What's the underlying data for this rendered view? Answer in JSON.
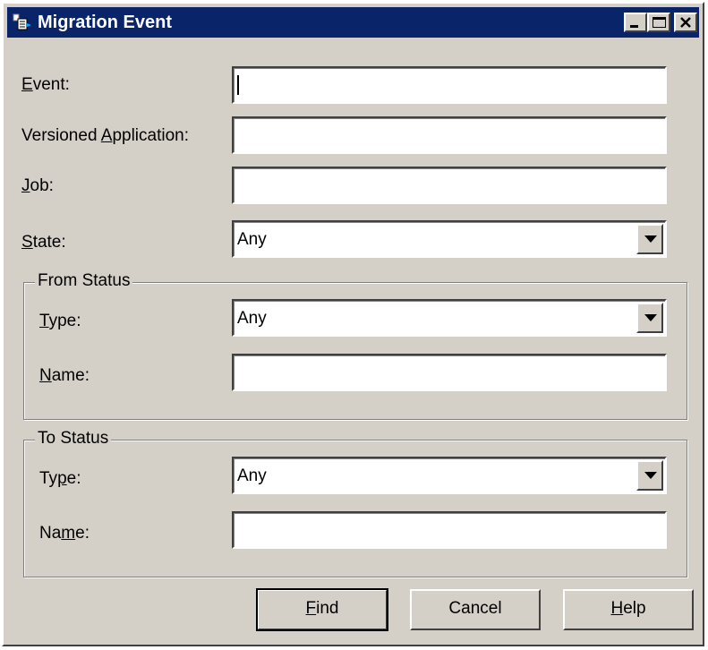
{
  "window": {
    "title": "Migration Event",
    "controls": {
      "minimize": "minimize",
      "maximize": "maximize",
      "close": "close"
    }
  },
  "form": {
    "event": {
      "label_mnemonic": "E",
      "label_rest": "vent:",
      "value": ""
    },
    "versioned_application": {
      "label_pre": "Versioned ",
      "label_mnemonic": "A",
      "label_rest": "pplication:",
      "value": ""
    },
    "job": {
      "label_mnemonic": "J",
      "label_rest": "ob:",
      "value": ""
    },
    "state": {
      "label_mnemonic": "S",
      "label_rest": "tate:",
      "selected": "Any"
    }
  },
  "from_status": {
    "title": "From Status",
    "type": {
      "label_mnemonic": "T",
      "label_rest": "ype:",
      "selected": "Any"
    },
    "name": {
      "label_mnemonic": "N",
      "label_rest": "ame:",
      "value": ""
    }
  },
  "to_status": {
    "title": "To Status",
    "type": {
      "label_pre": "Ty",
      "label_mnemonic": "p",
      "label_rest": "e:",
      "selected": "Any"
    },
    "name": {
      "label_pre": "Na",
      "label_mnemonic": "m",
      "label_rest": "e:",
      "value": ""
    }
  },
  "buttons": {
    "find": {
      "mnemonic": "F",
      "rest": "ind"
    },
    "cancel": {
      "label": "Cancel"
    },
    "help": {
      "mnemonic": "H",
      "rest": "elp"
    }
  },
  "colors": {
    "titlebar": "#0a246a",
    "face": "#d4d0c8",
    "field": "#ffffff"
  },
  "icons": {
    "app": "window-app-icon",
    "dropdown": "dropdown-arrow-icon"
  }
}
